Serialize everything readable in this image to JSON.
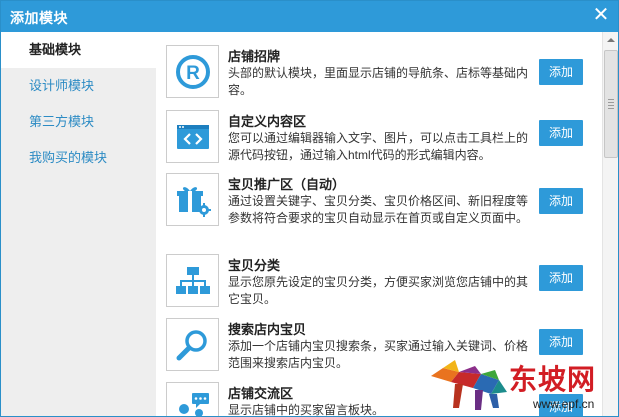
{
  "dialog": {
    "title": "添加模块",
    "close_icon": "close-icon"
  },
  "sidebar": {
    "items": [
      {
        "label": "基础模块",
        "active": true
      },
      {
        "label": "设计师模块",
        "active": false
      },
      {
        "label": "第三方模块",
        "active": false
      },
      {
        "label": "我购买的模块",
        "active": false
      }
    ]
  },
  "modules": [
    {
      "icon": "registered-icon",
      "title": "店铺招牌",
      "desc": "头部的默认模块，里面显示店铺的导航条、店标等基础内容。",
      "button": "添加"
    },
    {
      "icon": "code-icon",
      "title": "自定义内容区",
      "desc": "您可以通过编辑器输入文字、图片，可以点击工具栏上的源代码按钮，通过输入html代码的形式编辑内容。",
      "button": "添加"
    },
    {
      "icon": "gift-gear-icon",
      "title": "宝贝推广区（自动）",
      "desc": "通过设置关键字、宝贝分类、宝贝价格区间、新旧程度等参数将符合要求的宝贝自动显示在首页或自定义页面中。",
      "button": "添加"
    },
    {
      "icon": "category-tree-icon",
      "title": "宝贝分类",
      "desc": "显示您原先设定的宝贝分类，方便买家浏览您店铺中的其它宝贝。",
      "button": "添加"
    },
    {
      "icon": "search-icon",
      "title": "搜索店内宝贝",
      "desc": "添加一个店铺内宝贝搜索条，买家通过输入关键词、价格范围来搜索店内宝贝。",
      "button": "添加"
    },
    {
      "icon": "chat-users-icon",
      "title": "店铺交流区",
      "desc": "显示店铺中的买家留言板块。",
      "button": "添加"
    }
  ],
  "watermark": {
    "text": "东坡网",
    "url": "www.epf.cn"
  },
  "colors": {
    "accent": "#2e9ad9",
    "sidebar_bg": "#eeeeee",
    "link": "#2c8bc4",
    "watermark_red": "#d21d24"
  }
}
